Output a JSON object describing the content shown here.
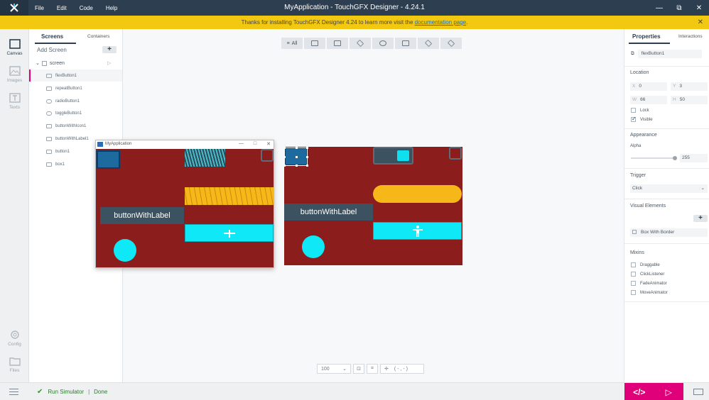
{
  "titlebar": {
    "title": "MyApplication - TouchGFX Designer - 4.24.1",
    "menu": [
      "File",
      "Edit",
      "Code",
      "Help"
    ],
    "controls": [
      "—",
      "⧉",
      "✕"
    ]
  },
  "banner": {
    "text_before": "Thanks for installing TouchGFX Designer 4.24 to learn more visit the ",
    "link": "documentation page",
    "text_after": ".",
    "close": "✕"
  },
  "leftnav": {
    "canvas": "Canvas",
    "images": "Images",
    "texts": "Texts",
    "config": "Config",
    "files": "Files"
  },
  "screens_panel": {
    "tab_screens": "Screens",
    "tab_containers": "Containers",
    "add_screen": "Add Screen",
    "add_plus": "+",
    "screen_name": "screen",
    "items": [
      "flexButton1",
      "repeatButton1",
      "radioButton1",
      "toggleButton1",
      "buttonWithIcon1",
      "buttonWithLabel1",
      "button1",
      "box1"
    ]
  },
  "toolbar": {
    "all": "All"
  },
  "simulator": {
    "title": "MyApplication",
    "controls": [
      "—",
      "□",
      "✕"
    ],
    "label_text": "buttonWithLabel"
  },
  "designer_screen": {
    "label_text": "buttonWithLabel"
  },
  "zoom": {
    "value": "100",
    "coords": "( - , - )"
  },
  "properties": {
    "tab_properties": "Properties",
    "tab_interactions": "Interactions",
    "name": "flexButton1",
    "location_header": "Location",
    "x_label": "X",
    "x_value": "0",
    "y_label": "Y",
    "y_value": "3",
    "w_label": "W",
    "w_value": "66",
    "h_label": "H",
    "h_value": "50",
    "lock": "Lock",
    "visible": "Visible",
    "appearance_header": "Appearance",
    "alpha_label": "Alpha",
    "alpha_value": "255",
    "trigger_header": "Trigger",
    "trigger_value": "Click",
    "visual_header": "Visual Elements",
    "visual_plus": "+",
    "visual_item": "Box With Border",
    "mixins_header": "Mixins",
    "mixins": [
      "Draggable",
      "ClickListener",
      "FadeAnimator",
      "MoveAnimator"
    ]
  },
  "bottombar": {
    "run": "Run Simulator",
    "sep": "|",
    "done": "Done",
    "code_btn": "</>",
    "play_btn": "▷"
  },
  "colors": {
    "titlebar": "#2d3e50",
    "banner": "#f2c811",
    "accent": "#e0007a",
    "screen_bg": "#8b1d1d",
    "cyan": "#0fe8f6",
    "yellow": "#f5b818"
  }
}
